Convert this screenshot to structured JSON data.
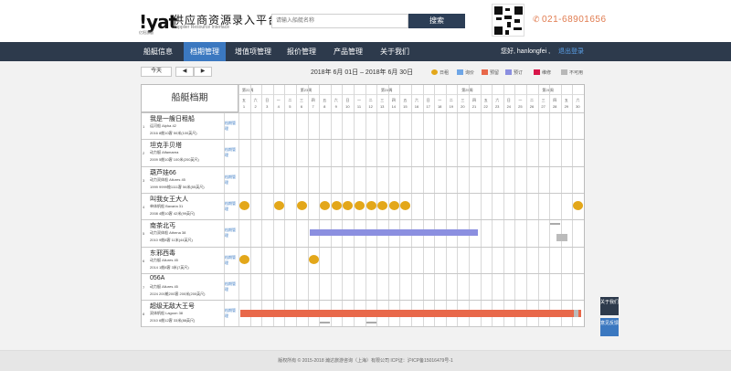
{
  "header": {
    "logo": "!yat",
    "logo_sub": "亿阳游艇",
    "title": "供应商资源录入平台",
    "subtitle": "Supplier Resource Interface",
    "search_placeholder": "请输入船艇名称",
    "search_button": "搜索",
    "phone": "021-68901656"
  },
  "nav": {
    "items": [
      "船艇信息",
      "档期管理",
      "增值项管理",
      "报价管理",
      "产品管理",
      "关于我们"
    ],
    "active_index": 1,
    "greeting": "您好, hanlongfei ,",
    "logout": "退出登录"
  },
  "toolbar": {
    "today": "今天",
    "prev": "◀",
    "next": "▶",
    "date_range": "2018年 6月 01日 – 2018年 6月 30日"
  },
  "legend": [
    {
      "label": "日租",
      "color": "#e3a71a",
      "shape": "circle"
    },
    {
      "label": "询价",
      "color": "#6fa6e6",
      "shape": "square"
    },
    {
      "label": "预留",
      "color": "#e8684a",
      "shape": "square"
    },
    {
      "label": "预订",
      "color": "#8b8fe0",
      "shape": "square"
    },
    {
      "label": "维修",
      "color": "#d8164a",
      "shape": "square"
    },
    {
      "label": "不可用",
      "color": "#b8b8b8",
      "shape": "square"
    }
  ],
  "calendar": {
    "title": "船艇档期",
    "weeks": [
      "第22周",
      "第23周",
      "第24周",
      "第25周",
      "第26周"
    ],
    "weekdays": [
      "五",
      "六",
      "日",
      "一",
      "二",
      "三",
      "四",
      "五",
      "六",
      "日",
      "一",
      "二",
      "三",
      "四",
      "五",
      "六",
      "日",
      "一",
      "二",
      "三",
      "四",
      "五",
      "六",
      "日",
      "一",
      "二",
      "三",
      "四",
      "五",
      "六"
    ],
    "days": [
      "1",
      "2",
      "3",
      "4",
      "5",
      "6",
      "7",
      "8",
      "9",
      "10",
      "11",
      "12",
      "13",
      "14",
      "15",
      "16",
      "17",
      "18",
      "19",
      "20",
      "21",
      "22",
      "23",
      "24",
      "25",
      "26",
      "27",
      "28",
      "29",
      "30"
    ]
  },
  "boats": [
    {
      "num": "1",
      "name": "我是一艘日租船",
      "model": "运河船 Alpha 42",
      "spec": "2016 8舱10客 50米(100英尺)",
      "link": "档期管理"
    },
    {
      "num": "2",
      "name": "坦克手贝塔",
      "model": "动力艇 Alfamarea",
      "spec": "2009 5舱10客 100米(200英尺)",
      "link": "档期管理"
    },
    {
      "num": "3",
      "name": "葫芦娃66",
      "model": "动力双体船 Allures 45",
      "spec": "1999 9999舱1111客 56米(55英尺)",
      "link": "档期管理"
    },
    {
      "num": "4",
      "name": "叫我女王大人",
      "model": "单体帆船 Bavaria 31",
      "spec": "2008 4舱10客 42米(99英尺)",
      "link": "档期管理"
    },
    {
      "num": "5",
      "name": "南茶北丐",
      "model": "动力双体船 Athena 38",
      "spec": "2010 9舱8客 11米(44英尺)",
      "link": "档期管理"
    },
    {
      "num": "6",
      "name": "东邪西毒",
      "model": "动力艇 Allures 45",
      "spec": "2014 1舱8客 3米(7英尺)",
      "link": "档期管理"
    },
    {
      "num": "7",
      "name": "056A",
      "model": "动力艇 Allures 45",
      "spec": "2024 200舱200客 200米(200英尺)",
      "link": "档期管理"
    },
    {
      "num": "8",
      "name": "超级无敌大王号",
      "model": "双体帆船 Lagoon 38",
      "spec": "2010 6舱12客 33米(88英尺)",
      "link": "档期管理"
    }
  ],
  "schedule": {
    "day_rentals": [
      {
        "boat": 4,
        "days": [
          1,
          4,
          6,
          8,
          9,
          10,
          11,
          12,
          13,
          14,
          15,
          30
        ]
      },
      {
        "boat": 6,
        "days": [
          1,
          7
        ]
      }
    ],
    "bookings": [
      {
        "boat": 5,
        "start": 7,
        "end": 21,
        "status": "预订"
      },
      {
        "boat": 8,
        "start": 1,
        "end": 30,
        "status": "预留"
      }
    ]
  },
  "side_buttons": [
    "关于我们",
    "意见反馈"
  ],
  "footer": "版权所有 © 2015-2018 瀚达旅游咨询（上海）有限公司  ICP证：沪ICP备15016479号-1"
}
